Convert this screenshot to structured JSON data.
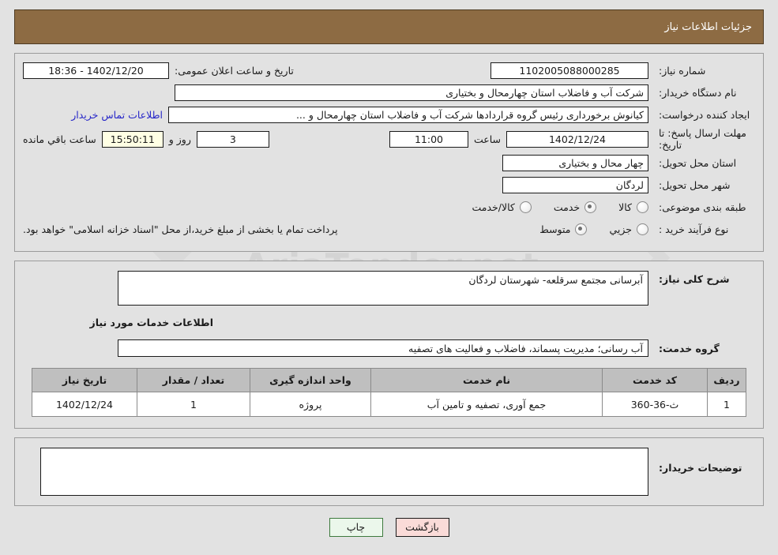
{
  "header": {
    "title": "جزئیات اطلاعات نیاز"
  },
  "colors": {
    "header_bg": "#8d6b43",
    "page_bg": "#e2e2e2",
    "link": "#2727c8",
    "table_header_bg": "#bfbfbf",
    "print_button_bg": "#ebf7eb",
    "back_button_bg": "#fadbd8",
    "countdown_bg": "#ffffe4"
  },
  "summary": {
    "need_number_label": "شماره نیاز:",
    "need_number_value": "1102005088000285",
    "announce_label": "تاریخ و ساعت اعلان عمومی:",
    "announce_value": "1402/12/20 - 18:36",
    "buyer_org_label": "نام دستگاه خریدار:",
    "buyer_org_value": "شرکت آب و فاضلاب استان چهارمحال و بختیاری",
    "creator_label": "ایجاد کننده درخواست:",
    "creator_value": "کیانوش برخورداری رئیس گروه قراردادها شرکت آب و فاضلاب استان چهارمحال و ...",
    "contact_link": "اطلاعات تماس خریدار",
    "deadline_label": "مهلت ارسال پاسخ: تا تاریخ:",
    "deadline_date": "1402/12/24",
    "deadline_time_label": "ساعت",
    "deadline_time": "11:00",
    "remaining_days": "3",
    "remaining_days_label": "روز و",
    "remaining_clock": "15:50:11",
    "remaining_clock_label": "ساعت باقي مانده",
    "province_label": "استان محل تحویل:",
    "province_value": "چهار محال و بختیاری",
    "city_label": "شهر محل تحویل:",
    "city_value": "لردگان",
    "category_label": "طبقه بندی موضوعی:",
    "category_options": [
      {
        "label": "کالا",
        "selected": false
      },
      {
        "label": "خدمت",
        "selected": true
      },
      {
        "label": "کالا/خدمت",
        "selected": false
      }
    ],
    "process_label": "نوع فرآیند خرید :",
    "process_options": [
      {
        "label": "جزیي",
        "selected": false
      },
      {
        "label": "متوسط",
        "selected": true
      }
    ],
    "treasury_note": "پرداخت تمام یا بخشی از مبلغ خرید،از محل \"اسناد خزانه اسلامی\" خواهد بود."
  },
  "description": {
    "general_need_label": "شرح کلی نیاز:",
    "general_need_value": "آبرسانی مجتمع سرقلعه- شهرستان لردگان",
    "services_section_title": "اطلاعات خدمات مورد نیاز",
    "service_group_label": "گروه خدمت:",
    "service_group_value": "آب رسانی؛ مدیریت پسماند، فاضلاب و فعالیت های تصفیه"
  },
  "items_table": {
    "columns": [
      "ردیف",
      "کد خدمت",
      "نام خدمت",
      "واحد اندازه گیری",
      "تعداد / مقدار",
      "تاریخ نیاز"
    ],
    "rows": [
      {
        "radif": "1",
        "code": "ث-36-360",
        "name": "جمع آوری، تصفیه و تامین آب",
        "unit": "پروژه",
        "quantity": "1",
        "date": "1402/12/24"
      }
    ]
  },
  "comments": {
    "label": "توضیحات خریدار:",
    "value": ""
  },
  "footer": {
    "print_label": "چاپ",
    "back_label": "بازگشت"
  },
  "watermark": {
    "text": "AriaTender.net"
  }
}
